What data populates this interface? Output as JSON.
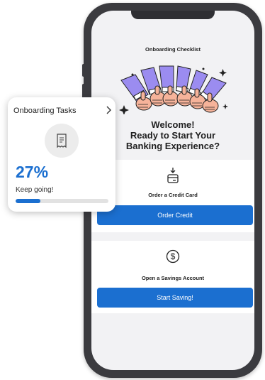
{
  "screen": {
    "title": "Onboarding Checklist",
    "welcome_line1": "Welcome!",
    "welcome_line2": "Ready to Start Your",
    "welcome_line3": "Banking Experience?"
  },
  "tasks": [
    {
      "title": "Order a Credit Card",
      "button": "Order Credit",
      "icon": "credit-card-icon"
    },
    {
      "title": "Open a Savings Account",
      "button": "Start Saving!",
      "icon": "dollar-coin-icon"
    }
  ],
  "card": {
    "title": "Onboarding Tasks",
    "percent": "27%",
    "note": "Keep going!",
    "progress": 0.27,
    "icon": "receipt-icon"
  },
  "colors": {
    "accent": "#1b6fd0",
    "illustration_sleeve": "#9b8cf0",
    "skin": "#f6b39a"
  }
}
